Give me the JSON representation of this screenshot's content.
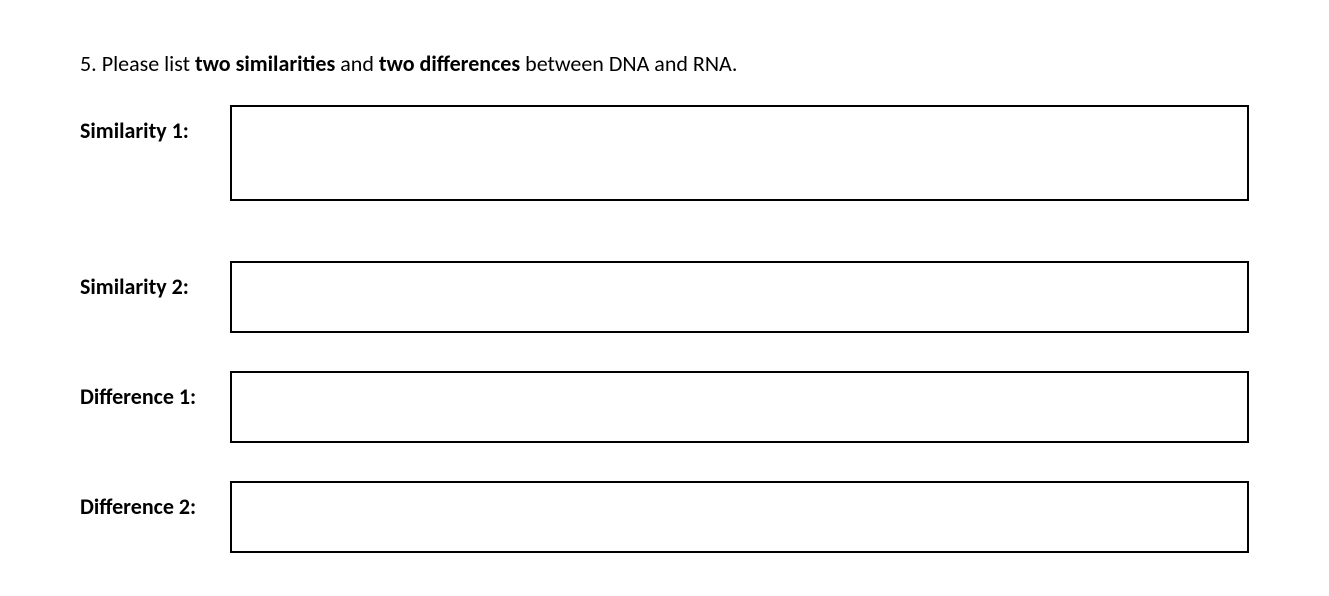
{
  "question": {
    "number": "5.",
    "prefix": "Please list ",
    "bold1": "two similarities",
    "mid": " and ",
    "bold2": "two differences",
    "suffix": " between DNA and RNA."
  },
  "fields": {
    "similarity1": {
      "label": "Similarity 1:",
      "value": ""
    },
    "similarity2": {
      "label": "Similarity 2:",
      "value": ""
    },
    "difference1": {
      "label": "Difference 1:",
      "value": ""
    },
    "difference2": {
      "label": "Difference 2:",
      "value": ""
    }
  }
}
